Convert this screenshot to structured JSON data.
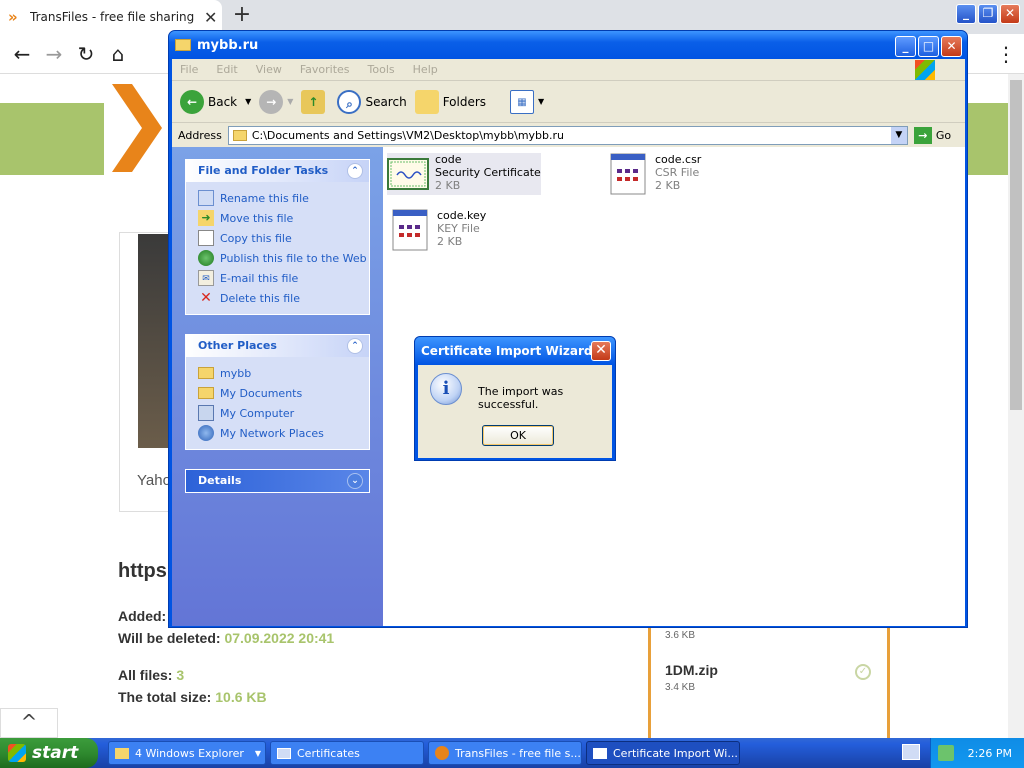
{
  "browser": {
    "tab_title": "TransFiles - free file sharing service",
    "nav": {
      "back": "←",
      "forward": "→",
      "reload": "↻",
      "home": "⌂",
      "menu": "⋮"
    }
  },
  "page": {
    "partial_heading": "https",
    "caption": "Yaho",
    "added_label": "Added:",
    "deleted_label": "Will be deleted:",
    "deleted_value": "07.09.2022 20:41",
    "files_label": "All files:",
    "files_value": "3",
    "size_label": "The total size:",
    "size_value": "10.6 KB",
    "list": [
      {
        "size": "3.6 KB"
      },
      {
        "name": "1DM.zip",
        "size": "3.4 KB"
      }
    ],
    "colors": {
      "accent": "#e8a03a",
      "green": "#a8c46c",
      "value": "#a8c46c"
    }
  },
  "explorer": {
    "title": "mybb.ru",
    "menu": [
      "File",
      "Edit",
      "View",
      "Favorites",
      "Tools",
      "Help"
    ],
    "toolbar": {
      "back": "Back",
      "search": "Search",
      "folders": "Folders"
    },
    "address_label": "Address",
    "address": "C:\\Documents and Settings\\VM2\\Desktop\\mybb\\mybb.ru",
    "go": "Go",
    "tasks": {
      "title": "File and Folder Tasks",
      "items": [
        {
          "label": "Rename this file",
          "icon": "rename-icon"
        },
        {
          "label": "Move this file",
          "icon": "move-icon"
        },
        {
          "label": "Copy this file",
          "icon": "copy-icon"
        },
        {
          "label": "Publish this file to the Web",
          "icon": "globe-icon"
        },
        {
          "label": "E-mail this file",
          "icon": "email-icon"
        },
        {
          "label": "Delete this file",
          "icon": "delete-icon"
        }
      ]
    },
    "places": {
      "title": "Other Places",
      "items": [
        {
          "label": "mybb",
          "icon": "folder-icon"
        },
        {
          "label": "My Documents",
          "icon": "documents-icon"
        },
        {
          "label": "My Computer",
          "icon": "computer-icon"
        },
        {
          "label": "My Network Places",
          "icon": "network-icon"
        }
      ]
    },
    "details": {
      "title": "Details"
    },
    "files": [
      {
        "name": "code",
        "type": "Security Certificate",
        "size": "2 KB"
      },
      {
        "name": "code.csr",
        "type": "CSR File",
        "size": "2 KB"
      },
      {
        "name": "code.key",
        "type": "KEY File",
        "size": "2 KB"
      }
    ]
  },
  "dialog": {
    "title": "Certificate Import Wizard",
    "message": "The import was successful.",
    "ok": "OK"
  },
  "taskbar": {
    "start": "start",
    "tasks": [
      {
        "label": "4 Windows Explorer"
      },
      {
        "label": "Certificates"
      },
      {
        "label": "TransFiles - free file s..."
      },
      {
        "label": "Certificate Import Wi..."
      }
    ],
    "clock": "2:26 PM"
  }
}
